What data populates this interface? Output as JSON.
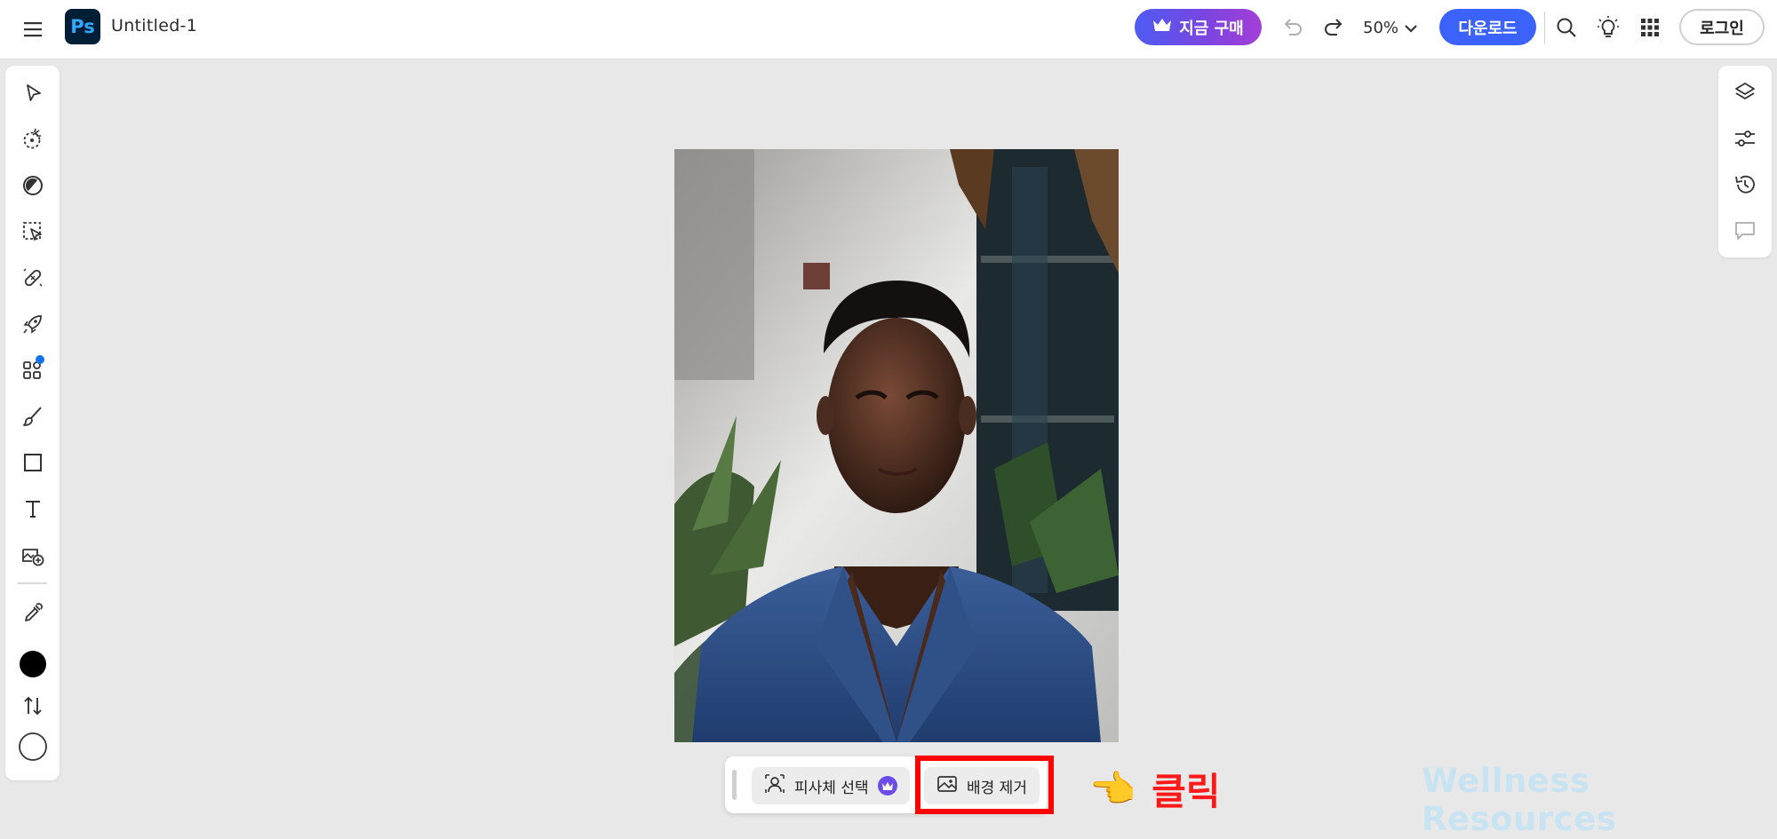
{
  "app": {
    "logo_text": "Ps",
    "document_title": "Untitled-1"
  },
  "topbar": {
    "buy_label": "지금 구매",
    "zoom_value": "50%",
    "download_label": "다운로드",
    "login_label": "로그인",
    "icons": [
      "menu-icon",
      "crown-icon",
      "undo-icon",
      "redo-icon",
      "chevron-down-icon",
      "search-icon",
      "lightbulb-icon",
      "apps-grid-icon"
    ]
  },
  "left_tools": [
    {
      "name": "select-tool-icon"
    },
    {
      "name": "quick-select-tool-icon"
    },
    {
      "name": "adjust-tool-icon"
    },
    {
      "name": "object-select-tool-icon"
    },
    {
      "name": "healing-tool-icon"
    },
    {
      "name": "quick-actions-icon"
    },
    {
      "name": "add-ons-icon"
    },
    {
      "name": "brush-tool-icon"
    },
    {
      "name": "shape-tool-icon"
    },
    {
      "name": "text-tool-icon"
    },
    {
      "name": "add-image-icon"
    },
    {
      "name": "eyedropper-tool-icon"
    },
    {
      "name": "foreground-color-swatch",
      "color": "#000000"
    },
    {
      "name": "swap-colors-icon"
    },
    {
      "name": "background-color-swatch",
      "color": "#ffffff"
    }
  ],
  "right_tools": [
    "layers-icon",
    "adjustments-icon",
    "history-icon",
    "comments-icon"
  ],
  "taskbar": {
    "select_subject_label": "피사체 선택",
    "remove_background_label": "배경 제거"
  },
  "annotation": {
    "click_label": "클릭",
    "pointer_glyph": "👈"
  },
  "watermark": "Wellness Resources",
  "colors": {
    "accent_blue": "#3b63fb",
    "highlight_red": "#ff0000",
    "premium_purple": "#6c4ce6"
  }
}
